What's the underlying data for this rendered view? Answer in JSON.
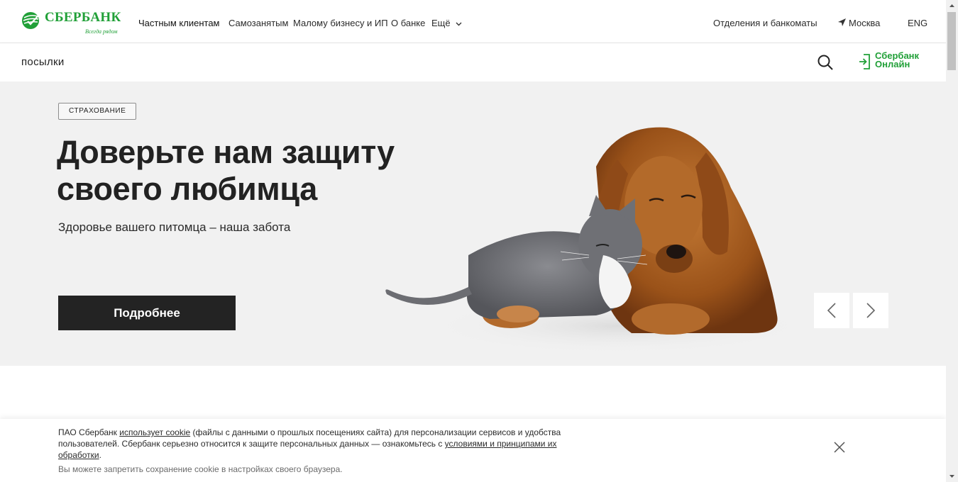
{
  "brand": {
    "name": "СБЕРБАНК",
    "tagline": "Всегда рядом",
    "green": "#21a038"
  },
  "nav": {
    "items": [
      "Частным клиентам",
      "Самозанятым",
      "Малому бизнесу и ИП",
      "О банке",
      "Ещё"
    ],
    "branches": "Отделения и банкоматы",
    "city": "Москва",
    "lang": "ENG"
  },
  "subbar": {
    "title": "посылки",
    "online_line1": "Сбербанк",
    "online_line2": "Онлайн"
  },
  "hero": {
    "badge": "СТРАХОВАНИЕ",
    "title_line1": "Доверьте нам защиту",
    "title_line2": "своего любимца",
    "subtitle": "Здоровье вашего питомца – наша забота",
    "button": "Подробнее"
  },
  "cookie": {
    "t1": "ПАО Сбербанк ",
    "link1": "использует cookie",
    "t2": " (файлы с данными о прошлых посещениях сайта) для персонализации сервисов и удобства пользователей. Сбербанк серьезно относится к защите персональных данных — ознакомьтесь с ",
    "link2": "условиями и принципами их обработки",
    "t3": ".",
    "note": "Вы можете запретить сохранение cookie в настройках своего браузера."
  },
  "icons": {
    "logo": "sberbank-logo-icon",
    "search": "search-icon",
    "login": "login-icon",
    "location": "location-arrow-icon",
    "prev": "chevron-left-icon",
    "next": "chevron-right-icon",
    "close": "close-icon"
  }
}
